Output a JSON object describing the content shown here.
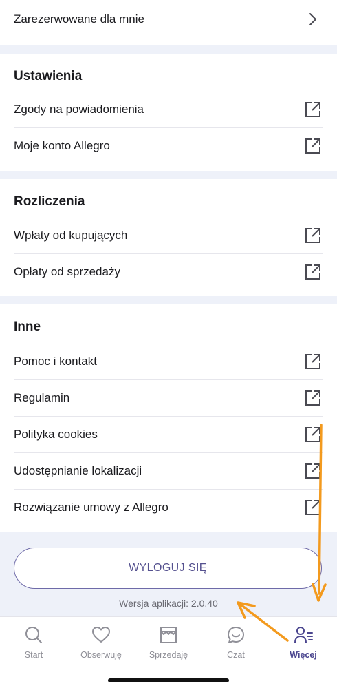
{
  "top_row": {
    "label": "Zarezerwowane dla mnie"
  },
  "settings": {
    "title": "Ustawienia",
    "items": [
      {
        "label": "Zgody na powiadomienia"
      },
      {
        "label": "Moje konto Allegro"
      }
    ]
  },
  "billing": {
    "title": "Rozliczenia",
    "items": [
      {
        "label": "Wpłaty od kupujących"
      },
      {
        "label": "Opłaty od sprzedaży"
      }
    ]
  },
  "other": {
    "title": "Inne",
    "items": [
      {
        "label": "Pomoc i kontakt"
      },
      {
        "label": "Regulamin"
      },
      {
        "label": "Polityka cookies"
      },
      {
        "label": "Udostępnianie lokalizacji"
      },
      {
        "label": "Rozwiązanie umowy z Allegro"
      }
    ]
  },
  "logout_label": "WYLOGUJ SIĘ",
  "version_text": "Wersja aplikacji: 2.0.40",
  "tabs": [
    {
      "label": "Start",
      "icon": "search-icon"
    },
    {
      "label": "Obserwuję",
      "icon": "heart-icon"
    },
    {
      "label": "Sprzedaję",
      "icon": "store-icon"
    },
    {
      "label": "Czat",
      "icon": "chat-icon"
    },
    {
      "label": "Więcej",
      "icon": "user-menu-icon",
      "active": true
    }
  ],
  "colors": {
    "accent": "#4b468f",
    "background": "#eef1f9",
    "annotation_arrow": "#f39a1e"
  }
}
